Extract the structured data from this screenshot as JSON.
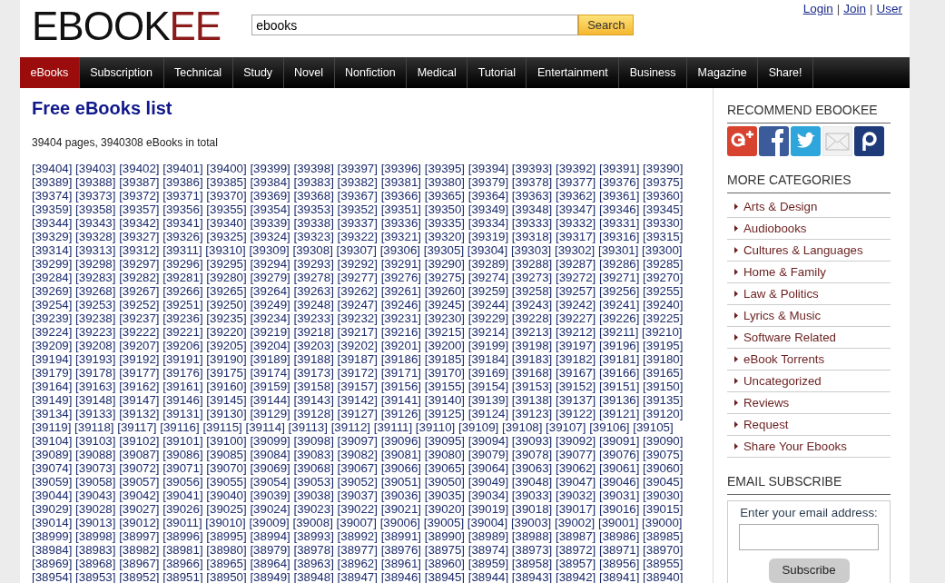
{
  "logo": {
    "main": "EBOOK",
    "accent": "EE"
  },
  "search": {
    "value": "ebooks",
    "button": "Search"
  },
  "user_links": {
    "items": [
      "Login",
      "Join",
      "User"
    ],
    "separator": "|"
  },
  "nav": [
    {
      "label": "eBooks",
      "selected": true
    },
    {
      "label": "Subscription",
      "selected": false
    },
    {
      "label": "Technical",
      "selected": false
    },
    {
      "label": "Study",
      "selected": false
    },
    {
      "label": "Novel",
      "selected": false
    },
    {
      "label": "Nonfiction",
      "selected": false
    },
    {
      "label": "Medical",
      "selected": false
    },
    {
      "label": "Tutorial",
      "selected": false
    },
    {
      "label": "Entertainment",
      "selected": false
    },
    {
      "label": "Business",
      "selected": false
    },
    {
      "label": "Magazine",
      "selected": false
    },
    {
      "label": "Share!",
      "selected": false
    }
  ],
  "main": {
    "title": "Free eBooks list",
    "summary": "39404 pages, 3940308 eBooks in total",
    "page_rows": [
      [
        "[39404]",
        "[39403]",
        "[39402]",
        "[39401]",
        "[39400]",
        "[39399]",
        "[39398]",
        "[39397]",
        "[39396]",
        "[39395]",
        "[39394]",
        "[39393]",
        "[39392]",
        "[39391]",
        "[39390]"
      ],
      [
        "[39389]",
        "[39388]",
        "[39387]",
        "[39386]",
        "[39385]",
        "[39384]",
        "[39383]",
        "[39382]",
        "[39381]",
        "[39380]",
        "[39379]",
        "[39378]",
        "[39377]",
        "[39376]",
        "[39375]"
      ],
      [
        "[39374]",
        "[39373]",
        "[39372]",
        "[39371]",
        "[39370]",
        "[39369]",
        "[39368]",
        "[39367]",
        "[39366]",
        "[39365]",
        "[39364]",
        "[39363]",
        "[39362]",
        "[39361]",
        "[39360]"
      ],
      [
        "[39359]",
        "[39358]",
        "[39357]",
        "[39356]",
        "[39355]",
        "[39354]",
        "[39353]",
        "[39352]",
        "[39351]",
        "[39350]",
        "[39349]",
        "[39348]",
        "[39347]",
        "[39346]",
        "[39345]"
      ],
      [
        "[39344]",
        "[39343]",
        "[39342]",
        "[39341]",
        "[39340]",
        "[39339]",
        "[39338]",
        "[39337]",
        "[39336]",
        "[39335]",
        "[39334]",
        "[39333]",
        "[39332]",
        "[39331]",
        "[39330]"
      ],
      [
        "[39329]",
        "[39328]",
        "[39327]",
        "[39326]",
        "[39325]",
        "[39324]",
        "[39323]",
        "[39322]",
        "[39321]",
        "[39320]",
        "[39319]",
        "[39318]",
        "[39317]",
        "[39316]",
        "[39315]"
      ],
      [
        "[39314]",
        "[39313]",
        "[39312]",
        "[39311]",
        "[39310]",
        "[39309]",
        "[39308]",
        "[39307]",
        "[39306]",
        "[39305]",
        "[39304]",
        "[39303]",
        "[39302]",
        "[39301]",
        "[39300]"
      ],
      [
        "[39299]",
        "[39298]",
        "[39297]",
        "[39296]",
        "[39295]",
        "[39294]",
        "[39293]",
        "[39292]",
        "[39291]",
        "[39290]",
        "[39289]",
        "[39288]",
        "[39287]",
        "[39286]",
        "[39285]"
      ],
      [
        "[39284]",
        "[39283]",
        "[39282]",
        "[39281]",
        "[39280]",
        "[39279]",
        "[39278]",
        "[39277]",
        "[39276]",
        "[39275]",
        "[39274]",
        "[39273]",
        "[39272]",
        "[39271]",
        "[39270]"
      ],
      [
        "[39269]",
        "[39268]",
        "[39267]",
        "[39266]",
        "[39265]",
        "[39264]",
        "[39263]",
        "[39262]",
        "[39261]",
        "[39260]",
        "[39259]",
        "[39258]",
        "[39257]",
        "[39256]",
        "[39255]"
      ],
      [
        "[39254]",
        "[39253]",
        "[39252]",
        "[39251]",
        "[39250]",
        "[39249]",
        "[39248]",
        "[39247]",
        "[39246]",
        "[39245]",
        "[39244]",
        "[39243]",
        "[39242]",
        "[39241]",
        "[39240]"
      ],
      [
        "[39239]",
        "[39238]",
        "[39237]",
        "[39236]",
        "[39235]",
        "[39234]",
        "[39233]",
        "[39232]",
        "[39231]",
        "[39230]",
        "[39229]",
        "[39228]",
        "[39227]",
        "[39226]",
        "[39225]"
      ],
      [
        "[39224]",
        "[39223]",
        "[39222]",
        "[39221]",
        "[39220]",
        "[39219]",
        "[39218]",
        "[39217]",
        "[39216]",
        "[39215]",
        "[39214]",
        "[39213]",
        "[39212]",
        "[39211]",
        "[39210]"
      ],
      [
        "[39209]",
        "[39208]",
        "[39207]",
        "[39206]",
        "[39205]",
        "[39204]",
        "[39203]",
        "[39202]",
        "[39201]",
        "[39200]",
        "[39199]",
        "[39198]",
        "[39197]",
        "[39196]",
        "[39195]"
      ],
      [
        "[39194]",
        "[39193]",
        "[39192]",
        "[39191]",
        "[39190]",
        "[39189]",
        "[39188]",
        "[39187]",
        "[39186]",
        "[39185]",
        "[39184]",
        "[39183]",
        "[39182]",
        "[39181]",
        "[39180]"
      ],
      [
        "[39179]",
        "[39178]",
        "[39177]",
        "[39176]",
        "[39175]",
        "[39174]",
        "[39173]",
        "[39172]",
        "[39171]",
        "[39170]",
        "[39169]",
        "[39168]",
        "[39167]",
        "[39166]",
        "[39165]"
      ],
      [
        "[39164]",
        "[39163]",
        "[39162]",
        "[39161]",
        "[39160]",
        "[39159]",
        "[39158]",
        "[39157]",
        "[39156]",
        "[39155]",
        "[39154]",
        "[39153]",
        "[39152]",
        "[39151]",
        "[39150]"
      ],
      [
        "[39149]",
        "[39148]",
        "[39147]",
        "[39146]",
        "[39145]",
        "[39144]",
        "[39143]",
        "[39142]",
        "[39141]",
        "[39140]",
        "[39139]",
        "[39138]",
        "[39137]",
        "[39136]",
        "[39135]"
      ],
      [
        "[39134]",
        "[39133]",
        "[39132]",
        "[39131]",
        "[39130]",
        "[39129]",
        "[39128]",
        "[39127]",
        "[39126]",
        "[39125]",
        "[39124]",
        "[39123]",
        "[39122]",
        "[39121]",
        "[39120]"
      ],
      [
        "[39119]",
        "[39118]",
        "[39117]",
        "[39116]",
        "[39115]",
        "[39114]",
        "[39113]",
        "[39112]",
        "[39111]",
        "[39110]",
        "[39109]",
        "[39108]",
        "[39107]",
        "[39106]",
        "[39105]"
      ],
      [
        "[39104]",
        "[39103]",
        "[39102]",
        "[39101]",
        "[39100]",
        "[39099]",
        "[39098]",
        "[39097]",
        "[39096]",
        "[39095]",
        "[39094]",
        "[39093]",
        "[39092]",
        "[39091]",
        "[39090]"
      ],
      [
        "[39089]",
        "[39088]",
        "[39087]",
        "[39086]",
        "[39085]",
        "[39084]",
        "[39083]",
        "[39082]",
        "[39081]",
        "[39080]",
        "[39079]",
        "[39078]",
        "[39077]",
        "[39076]",
        "[39075]"
      ],
      [
        "[39074]",
        "[39073]",
        "[39072]",
        "[39071]",
        "[39070]",
        "[39069]",
        "[39068]",
        "[39067]",
        "[39066]",
        "[39065]",
        "[39064]",
        "[39063]",
        "[39062]",
        "[39061]",
        "[39060]"
      ],
      [
        "[39059]",
        "[39058]",
        "[39057]",
        "[39056]",
        "[39055]",
        "[39054]",
        "[39053]",
        "[39052]",
        "[39051]",
        "[39050]",
        "[39049]",
        "[39048]",
        "[39047]",
        "[39046]",
        "[39045]"
      ],
      [
        "[39044]",
        "[39043]",
        "[39042]",
        "[39041]",
        "[39040]",
        "[39039]",
        "[39038]",
        "[39037]",
        "[39036]",
        "[39035]",
        "[39034]",
        "[39033]",
        "[39032]",
        "[39031]",
        "[39030]"
      ],
      [
        "[39029]",
        "[39028]",
        "[39027]",
        "[39026]",
        "[39025]",
        "[39024]",
        "[39023]",
        "[39022]",
        "[39021]",
        "[39020]",
        "[39019]",
        "[39018]",
        "[39017]",
        "[39016]",
        "[39015]"
      ],
      [
        "[39014]",
        "[39013]",
        "[39012]",
        "[39011]",
        "[39010]",
        "[39009]",
        "[39008]",
        "[39007]",
        "[39006]",
        "[39005]",
        "[39004]",
        "[39003]",
        "[39002]",
        "[39001]",
        "[39000]"
      ],
      [
        "[38999]",
        "[38998]",
        "[38997]",
        "[38996]",
        "[38995]",
        "[38994]",
        "[38993]",
        "[38992]",
        "[38991]",
        "[38990]",
        "[38989]",
        "[38988]",
        "[38987]",
        "[38986]",
        "[38985]"
      ],
      [
        "[38984]",
        "[38983]",
        "[38982]",
        "[38981]",
        "[38980]",
        "[38979]",
        "[38978]",
        "[38977]",
        "[38976]",
        "[38975]",
        "[38974]",
        "[38973]",
        "[38972]",
        "[38971]",
        "[38970]"
      ],
      [
        "[38969]",
        "[38968]",
        "[38967]",
        "[38966]",
        "[38965]",
        "[38964]",
        "[38963]",
        "[38962]",
        "[38961]",
        "[38960]",
        "[38959]",
        "[38958]",
        "[38957]",
        "[38956]",
        "[38955]"
      ],
      [
        "[38954]",
        "[38953]",
        "[38952]",
        "[38951]",
        "[38950]",
        "[38949]",
        "[38948]",
        "[38947]",
        "[38946]",
        "[38945]",
        "[38944]",
        "[38943]",
        "[38942]",
        "[38941]",
        "[38940]"
      ]
    ]
  },
  "sidebar": {
    "recommend_title": "RECOMMEND EBOOKEE",
    "social": [
      {
        "kind": "gplus"
      },
      {
        "kind": "facebook"
      },
      {
        "kind": "twitter"
      },
      {
        "kind": "email"
      },
      {
        "kind": "p"
      }
    ],
    "categories_title": "MORE CATEGORIES",
    "categories": [
      "Arts & Design",
      "Audiobooks",
      "Cultures & Languages",
      "Home & Family",
      "Law & Politics",
      "Lyrics & Music",
      "Software Related",
      "eBook Torrents",
      "Uncategorized",
      "Reviews",
      "Request",
      "Share Your Ebooks"
    ],
    "subscribe_title": "EMAIL SUBSCRIBE",
    "subscribe_label": "Enter your email address:",
    "subscribe_button": "Subscribe"
  }
}
